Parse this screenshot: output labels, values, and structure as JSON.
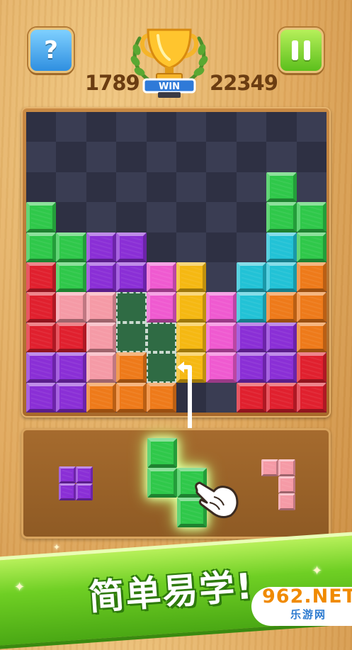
{
  "topbar": {
    "help_label": "?",
    "score_left": "1789",
    "score_right": "22349",
    "trophy_label": "WIN"
  },
  "board": {
    "rows": [
      [
        "",
        "",
        "",
        "",
        "",
        "",
        "",
        "",
        "",
        ""
      ],
      [
        "",
        "",
        "",
        "",
        "",
        "",
        "",
        "",
        "",
        ""
      ],
      [
        "",
        "",
        "",
        "",
        "",
        "",
        "",
        "",
        "green",
        ""
      ],
      [
        "green",
        "",
        "",
        "",
        "",
        "",
        "",
        "",
        "green",
        "green"
      ],
      [
        "green",
        "green",
        "purple",
        "purple",
        "",
        "",
        "",
        "",
        "cyan",
        "green"
      ],
      [
        "red",
        "green",
        "purple",
        "purple",
        "magenta",
        "yellow",
        "",
        "cyan",
        "cyan",
        "orange"
      ],
      [
        "red",
        "pink",
        "pink",
        "ghost",
        "magenta",
        "yellow",
        "magenta",
        "cyan",
        "orange",
        "orange"
      ],
      [
        "red",
        "red",
        "pink",
        "ghost",
        "ghost",
        "yellow",
        "magenta",
        "purple",
        "purple",
        "orange"
      ],
      [
        "purple",
        "purple",
        "pink",
        "orange",
        "ghost",
        "yellow",
        "magenta",
        "purple",
        "purple",
        "red"
      ],
      [
        "purple",
        "purple",
        "orange",
        "orange",
        "orange",
        "",
        "",
        "red",
        "red",
        "red"
      ]
    ]
  },
  "colors": {
    "green": "#2fc84a",
    "purple": "#8a2fd6",
    "red": "#e0202e",
    "cyan": "#22c2d6",
    "orange": "#ee7a1a",
    "yellow": "#f5b812",
    "magenta": "#ef5ad0",
    "pink": "#f59aa6"
  },
  "tray": {
    "pieces": [
      {
        "name": "purple-square-piece",
        "color": "purple"
      },
      {
        "name": "green-s-piece",
        "color": "green",
        "selected": true
      },
      {
        "name": "pink-l-piece",
        "color": "pink"
      }
    ]
  },
  "banner": {
    "text": "简单易学!"
  },
  "watermark": {
    "brand": "962.NET",
    "site": "乐游网"
  }
}
